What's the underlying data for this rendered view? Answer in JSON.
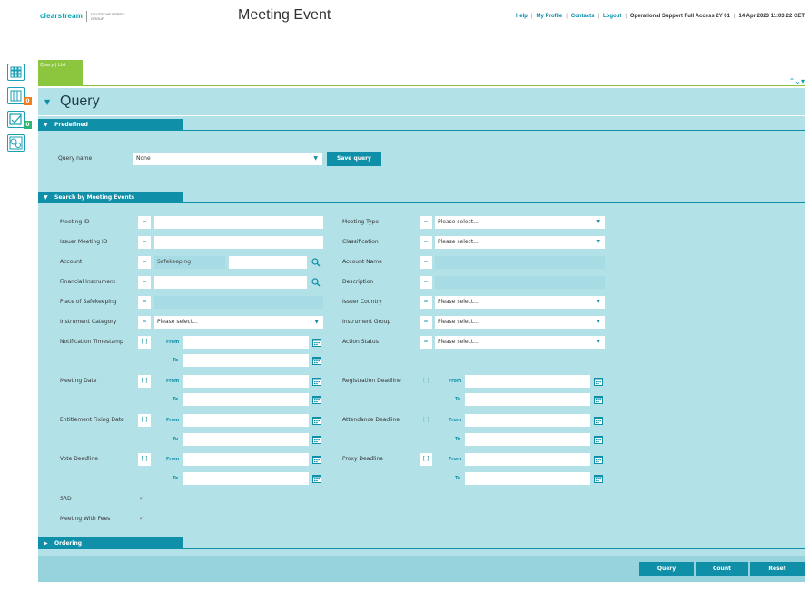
{
  "header": {
    "logo_text": "clearstream",
    "logo_group_line1": "DEUTSCHE BÖRSE",
    "logo_group_line2": "GROUP",
    "title": "Meeting Event",
    "nav": {
      "help": "Help",
      "profile": "My Profile",
      "contacts": "Contacts",
      "logout": "Logout",
      "role": "Operational Support Full Access 2Y 01",
      "timestamp": "14 Apr 2023 11:03:22 CET"
    }
  },
  "sidebar": {
    "badges": {
      "tasks": "0",
      "approvals": "0"
    }
  },
  "tab": {
    "label": "Query | List"
  },
  "query": {
    "title": "Query",
    "predefined": {
      "section_label": "Predefined",
      "query_name_label": "Query name",
      "query_name_value": "None",
      "save_button": "Save query"
    },
    "search": {
      "section_label": "Search by Meeting Events",
      "meeting_id_label": "Meeting ID",
      "issuer_meeting_id_label": "Issuer Meeting ID",
      "account_label": "Account",
      "account_value": "Safekeeping",
      "financial_instrument_label": "Financial Instrument",
      "place_of_safekeeping_label": "Place of Safekeeping",
      "instrument_category_label": "Instrument Category",
      "instrument_category_value": "Please select...",
      "notification_timestamp_label": "Notification Timestamp",
      "meeting_date_label": "Meeting Date",
      "entitlement_fixing_date_label": "Entitlement Fixing Date",
      "vote_deadline_label": "Vote Deadline",
      "srd_label": "SRD",
      "meeting_with_fees_label": "Meeting With Fees",
      "meeting_type_label": "Meeting Type",
      "meeting_type_value": "Please select...",
      "classification_label": "Classification",
      "classification_value": "Please select...",
      "account_name_label": "Account Name",
      "description_label": "Description",
      "issuer_country_label": "Issuer Country",
      "issuer_country_value": "Please select...",
      "instrument_group_label": "Instrument Group",
      "instrument_group_value": "Please select...",
      "action_status_label": "Action Status",
      "action_status_value": "Please select...",
      "registration_deadline_label": "Registration Deadline",
      "attendance_deadline_label": "Attendance Deadline",
      "proxy_deadline_label": "Proxy Deadline",
      "op_equals": "=",
      "op_range": "[ ]",
      "from_label": "From",
      "to_label": "To"
    },
    "ordering": {
      "section_label": "Ordering"
    }
  },
  "footer": {
    "query_button": "Query",
    "count_button": "Count",
    "reset_button": "Reset"
  },
  "colors": {
    "accent": "#108fa8",
    "panel": "#b3e1e8",
    "tab": "#8cc63f",
    "badge_orange": "#f07d1a",
    "badge_green": "#2bb673"
  }
}
